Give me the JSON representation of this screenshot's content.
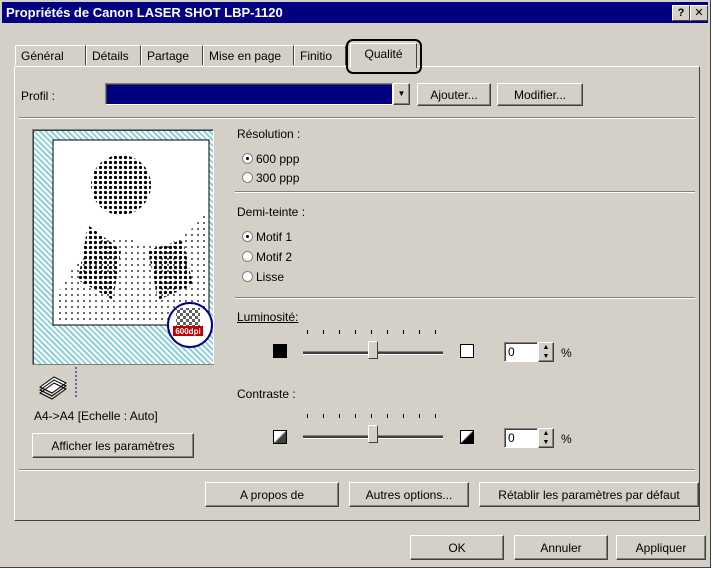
{
  "window": {
    "title": "Propriétés de Canon LASER SHOT LBP-1120",
    "help_btn": "?",
    "close_btn": "✕"
  },
  "tabs": [
    {
      "label": "Général"
    },
    {
      "label": "Détails"
    },
    {
      "label": "Partage"
    },
    {
      "label": "Mise en page"
    },
    {
      "label": "Finitio"
    },
    {
      "label": "Qualité",
      "active": true
    }
  ],
  "profile": {
    "label": "Profil :",
    "value": "",
    "add_button": "Ajouter...",
    "modify_button": "Modifier..."
  },
  "preview": {
    "badge": "600dpi",
    "caption": "A4->A4 [Echelle : Auto]",
    "show_params_button": "Afficher les paramètres"
  },
  "resolution": {
    "label": "Résolution :",
    "options": [
      "600 ppp",
      "300 ppp"
    ],
    "selected": "600 ppp"
  },
  "halftone": {
    "label": "Demi-teinte :",
    "options": [
      "Motif 1",
      "Motif 2",
      "Lisse"
    ],
    "selected": "Motif 1"
  },
  "brightness": {
    "label": "Luminosité:",
    "value": "0",
    "unit": "%",
    "slider_fraction": 0.5
  },
  "contrast": {
    "label": "Contraste :",
    "value": "0",
    "unit": "%",
    "slider_fraction": 0.5
  },
  "actions": {
    "about": "A propos de",
    "more_options": "Autres options...",
    "reset": "Rétablir les paramètres par défaut"
  },
  "footer": {
    "ok": "OK",
    "cancel": "Annuler",
    "apply": "Appliquer"
  },
  "colors": {
    "titlebar": "#000080",
    "profile_fill": "#000080",
    "preview_bg": "#8fd0d8",
    "dialog_face": "#d4d0c8"
  }
}
